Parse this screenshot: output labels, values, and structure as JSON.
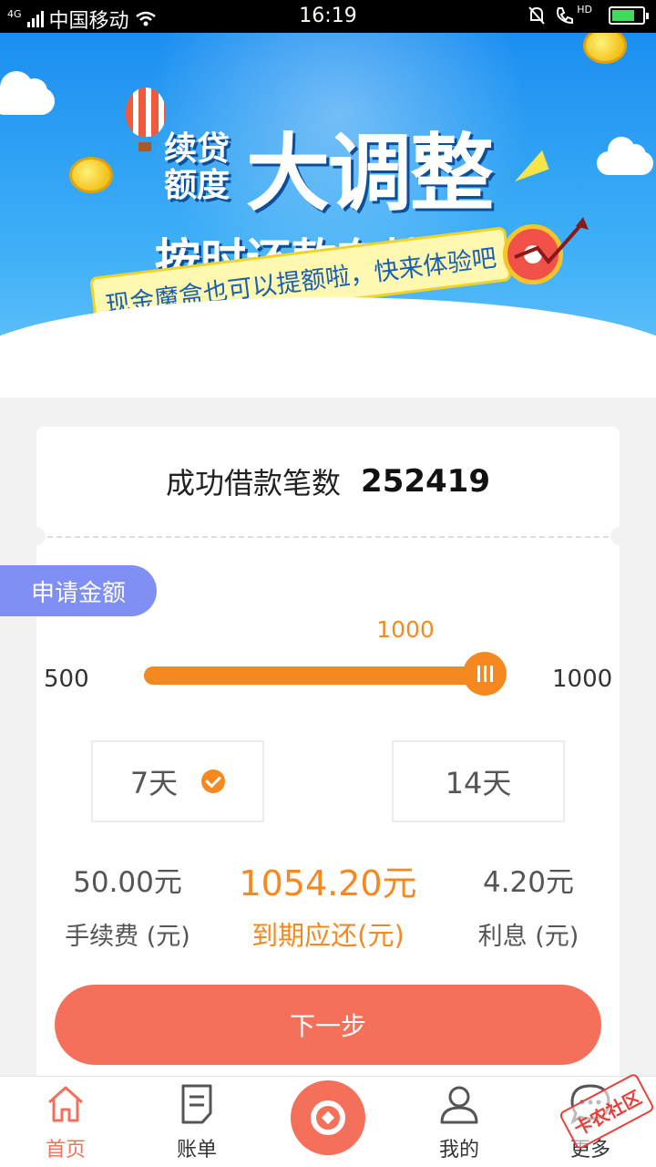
{
  "status_bar": {
    "network": "4G",
    "carrier": "中国移动",
    "time": "16:19",
    "hd": "HD"
  },
  "banner": {
    "headline_small": "续贷额度",
    "headline_big": "大调整",
    "headline_mid": "按时还款有惊喜",
    "ribbon_text": "现金魔盒也可以提额啦，快来体验吧"
  },
  "loan_count": {
    "label": "成功借款笔数",
    "value": "252419"
  },
  "amount": {
    "label": "申请金额",
    "current": "1000",
    "min": "500",
    "max": "1000",
    "fraction": 1.0
  },
  "terms": [
    {
      "label": "7天",
      "selected": true
    },
    {
      "label": "14天",
      "selected": false
    }
  ],
  "fees": {
    "service_fee_value": "50.00元",
    "service_fee_label": "手续费 (元)",
    "due_value": "1054.20元",
    "due_label": "到期应还(元)",
    "interest_value": "4.20元",
    "interest_label": "利息 (元)"
  },
  "next_button": "下一步",
  "nav": {
    "home": "首页",
    "bill": "账单",
    "mine": "我的",
    "more": "更多"
  },
  "watermark": "卡农社区",
  "colors": {
    "accent_orange": "#f5891f",
    "button_red": "#f5705a",
    "pill_purple": "#7f8ff4",
    "banner_blue": "#1b8ff0"
  }
}
